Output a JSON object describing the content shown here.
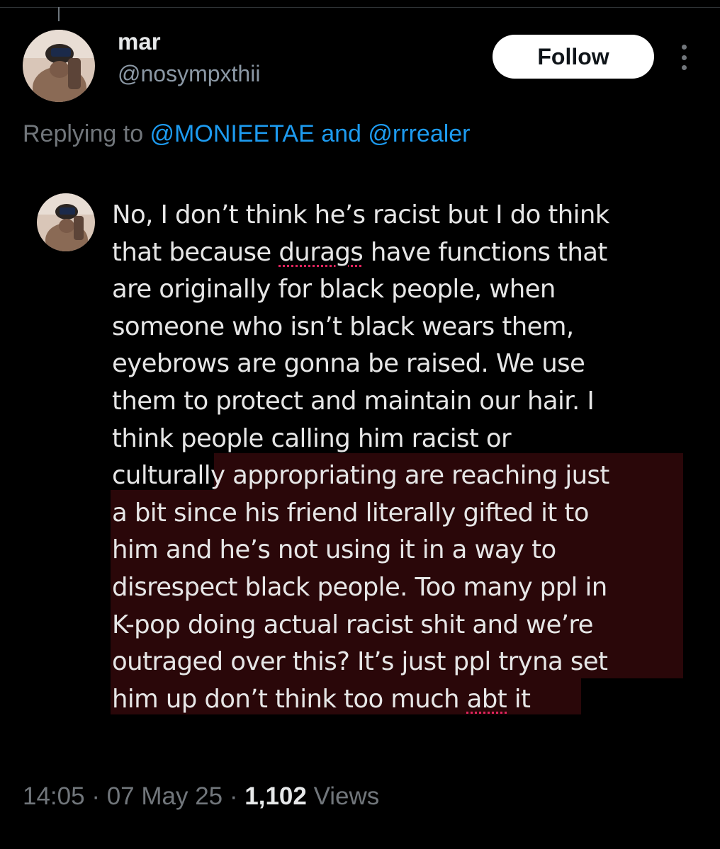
{
  "user": {
    "display_name": "mar",
    "handle": "@nosympxthii"
  },
  "header": {
    "follow_label": "Follow"
  },
  "reply": {
    "prefix": "Replying to ",
    "mention_1": "@MONIEETAE",
    "conjunction": " and ",
    "mention_2": "@rrrealer"
  },
  "quoted_text": {
    "lines": [
      "No, I don’t think he’s racist but I do think",
      "that because ",
      "durags",
      " have functions that",
      "are originally for black people, when",
      "someone who isn’t black wears them,",
      "eyebrows are gonna be raised. We use",
      "them to protect and maintain our hair. I",
      "think people calling him racist or",
      "culturally appropriating are reaching just",
      "a bit since his friend literally gifted it to",
      "him and he’s not using it in a way to",
      "disrespect black people. Too many ppl in",
      "K-pop doing actual racist shit and we’re",
      "outraged over this? It’s just ppl tryna set",
      "him up don’t think too much ",
      "abt",
      " it"
    ]
  },
  "meta": {
    "time": "14:05",
    "sep1": " · ",
    "date": "07 May 25",
    "sep2": " · ",
    "views_count": "1,102",
    "views_label": " Views"
  },
  "colors": {
    "background": "#000000",
    "link": "#1d9bf0",
    "secondary_text": "#71767b",
    "highlight": "#2a0709",
    "spellcheck_underline": "#e0245e"
  },
  "icons": {
    "more": "more-vertical-icon"
  }
}
